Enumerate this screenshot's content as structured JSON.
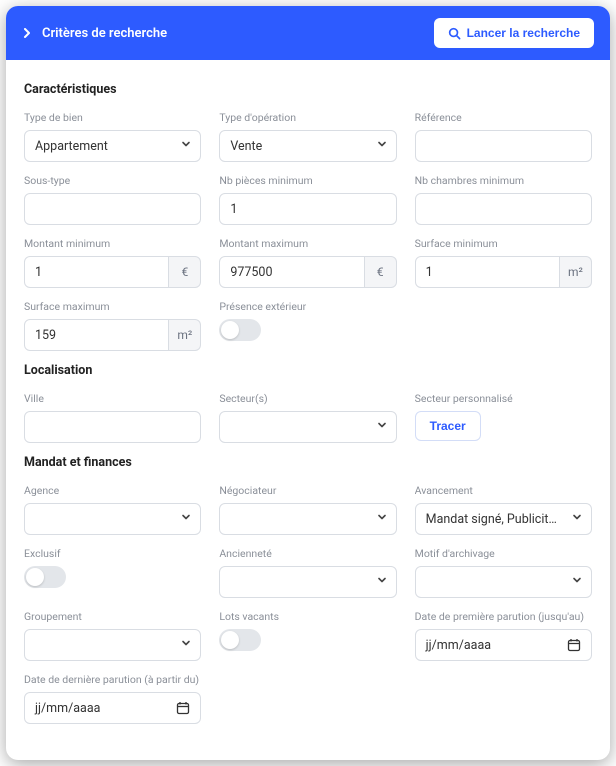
{
  "header": {
    "title": "Critères de recherche",
    "launch_label": "Lancer la recherche"
  },
  "sections": {
    "characteristics": "Caractéristiques",
    "location": "Localisation",
    "mandate": "Mandat et finances"
  },
  "labels": {
    "property_type": "Type de bien",
    "operation_type": "Type d'opération",
    "reference": "Référence",
    "subtype": "Sous-type",
    "min_rooms": "Nb pièces minimum",
    "min_bedrooms": "Nb chambres minimum",
    "min_amount": "Montant minimum",
    "max_amount": "Montant maximum",
    "min_surface": "Surface minimum",
    "max_surface": "Surface maximum",
    "exterior": "Présence extérieur",
    "city": "Ville",
    "sectors": "Secteur(s)",
    "custom_sector": "Secteur personnalisé",
    "agency": "Agence",
    "negotiator": "Négociateur",
    "progress": "Avancement",
    "exclusive": "Exclusif",
    "seniority": "Ancienneté",
    "archive_reason": "Motif d'archivage",
    "grouping": "Groupement",
    "vacant_lots": "Lots vacants",
    "first_pub_date": "Date de première parution (jusqu'au)",
    "last_pub_date": "Date de dernière parution (à partir du)"
  },
  "values": {
    "property_type": "Appartement",
    "operation_type": "Vente",
    "reference": "",
    "subtype": "",
    "min_rooms": "1",
    "min_bedrooms": "",
    "min_amount": "1",
    "max_amount": "977500",
    "min_surface": "1",
    "max_surface": "159",
    "city": "",
    "sectors": "",
    "agency": "",
    "negotiator": "",
    "progress": "Mandat signé, Publicité effectu…",
    "seniority": "",
    "archive_reason": "",
    "grouping": ""
  },
  "units": {
    "euro": "€",
    "sqm": "m²"
  },
  "buttons": {
    "trace": "Tracer"
  },
  "placeholders": {
    "date": "jj/mm/aaaa"
  }
}
